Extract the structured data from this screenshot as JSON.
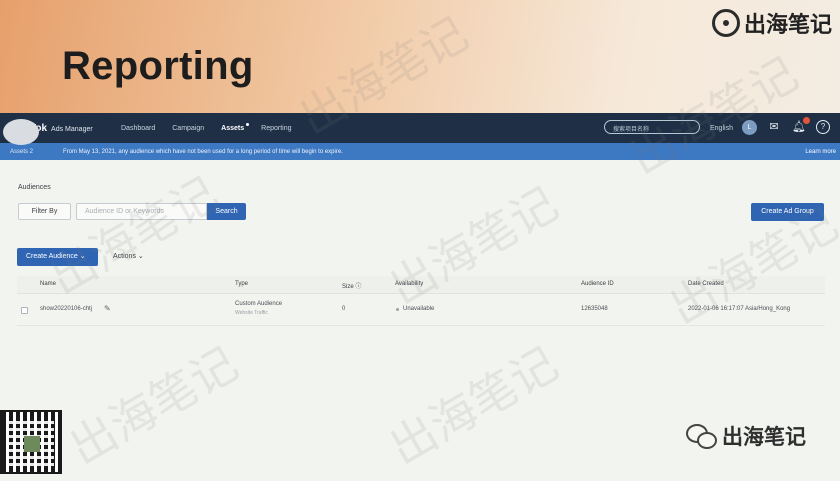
{
  "slide": {
    "title": "Reporting",
    "brand_text": "出海笔记"
  },
  "nav": {
    "brand": "Tok",
    "brand_sub": "Ads Manager",
    "links": [
      {
        "label": "Dashboard",
        "active": false
      },
      {
        "label": "Campaign",
        "active": false
      },
      {
        "label": "Assets",
        "active": true
      },
      {
        "label": "Reporting",
        "active": false
      }
    ],
    "search_placeholder": "搜索项目名称",
    "language": "English",
    "user_initial": "L"
  },
  "notice": {
    "prefix": "Assets 2",
    "text": "From May 13, 2021, any audience which have not been used for a long period of time will begin to expire.",
    "link": "Learn more"
  },
  "audiences": {
    "section_label": "Audiences",
    "filter_label": "Filter By",
    "id_placeholder": "Audience ID or Keywords",
    "search_label": "Search",
    "create_group_label": "Create Ad Group",
    "create_audience_label": "Create Audience ⌄",
    "actions_label": "Actions ⌄",
    "columns": [
      "Name",
      "Type",
      "Size ⓘ",
      "Availability",
      "Audience ID",
      "Date Created"
    ],
    "rows": [
      {
        "name": "show20220106-chtj",
        "type": "Custom Audience",
        "type_sub": "Website Traffic",
        "size": "0",
        "availability": "Unavailable",
        "audience_id": "12635048",
        "date_created": "2022-01-06 16:17:07 Asia/Hong_Kong"
      }
    ]
  },
  "overlay": {
    "watermark": "出海笔记",
    "wechat_text": "出海笔记"
  }
}
